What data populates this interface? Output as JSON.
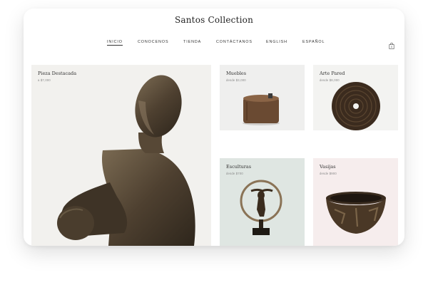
{
  "brand": {
    "name": "Santos Collection"
  },
  "nav": {
    "items": [
      {
        "label": "INICIO",
        "active": true
      },
      {
        "label": "CONOCENOS"
      },
      {
        "label": "TIENDA"
      },
      {
        "label": "CONTÁCTANOS"
      },
      {
        "label": "ENGLISH"
      },
      {
        "label": "ESPAÑOL"
      }
    ],
    "cart_icon": "shopping-bag-icon",
    "cart_count": "0"
  },
  "featured": {
    "title": "Pieza Destacada",
    "price": "a $7,000"
  },
  "tiles": [
    {
      "title": "Muebles",
      "price": "desde $3,000"
    },
    {
      "title": "Arte Pared",
      "price": "desde $8,000"
    },
    {
      "title": "Esculturas",
      "price": "desde $700"
    },
    {
      "title": "Vasijas",
      "price": "desde $900"
    }
  ],
  "colors": {
    "featured_bg": "#f2f1ee",
    "muebles_bg": "#efefee",
    "arte_bg": "#f3f3f1",
    "esculturas_bg": "#dfe6e2",
    "vasijas_bg": "#f6eded",
    "bronze": "#5a4a36"
  }
}
